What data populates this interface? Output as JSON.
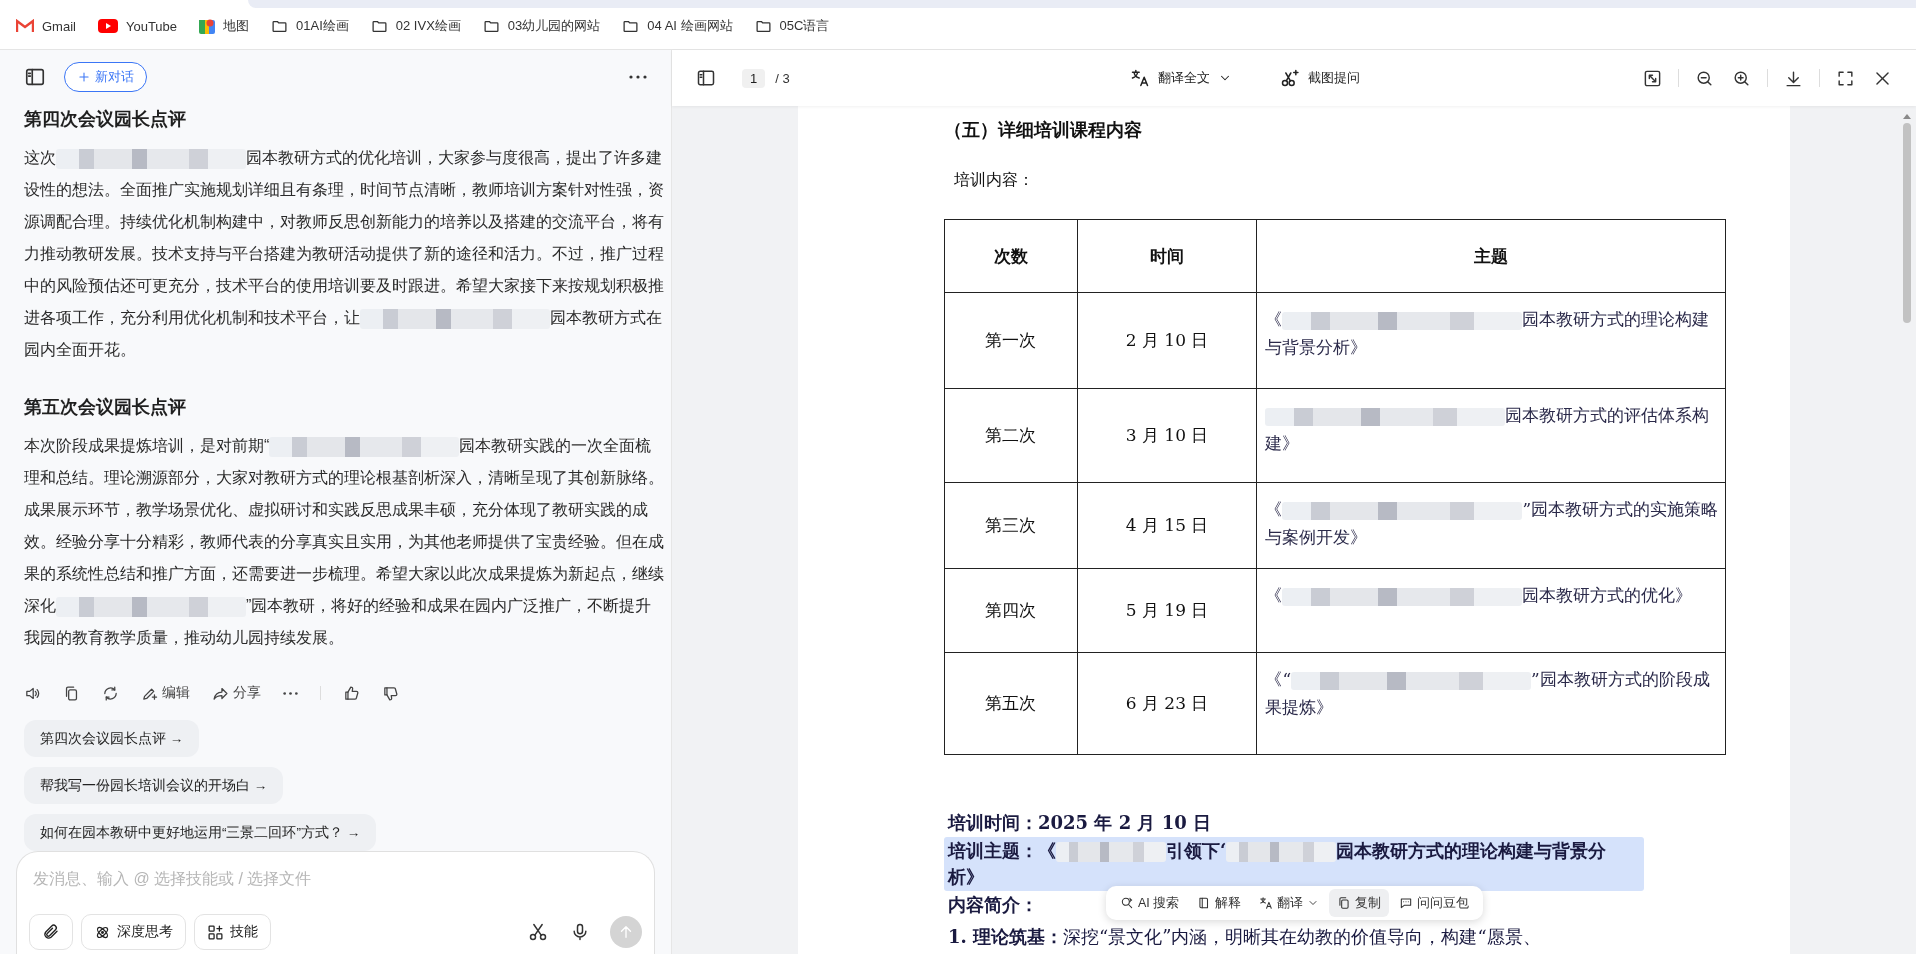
{
  "bookmarks": [
    {
      "kind": "gmail",
      "label": "Gmail"
    },
    {
      "kind": "youtube",
      "label": "YouTube"
    },
    {
      "kind": "maps",
      "label": "地图"
    },
    {
      "kind": "folder",
      "label": "01AI绘画"
    },
    {
      "kind": "folder",
      "label": "02 IVX绘画"
    },
    {
      "kind": "folder",
      "label": "03幼儿园的网站"
    },
    {
      "kind": "folder",
      "label": "04 AI 绘画网站"
    },
    {
      "kind": "folder",
      "label": "05C语言"
    }
  ],
  "chat": {
    "new_chat": "新对话",
    "blocks": [
      {
        "kind": "heading",
        "segments": [
          {
            "kind": "text",
            "text": "第四次会议园长点评"
          }
        ]
      },
      {
        "kind": "para",
        "segments": [
          {
            "kind": "text",
            "text": "这次"
          },
          {
            "kind": "blur"
          },
          {
            "kind": "text",
            "text": "园本教研方式的优化培训，大家参与度很高，提出了许多建设性的想法。全面推广实施规划详细且有条理，时间节点清晰，教师培训方案针对性强，资源调配合理。持续优化机制构建中，对教师反思创新能力的培养以及搭建的交流平台，将有力推动教研发展。技术支持与平台搭建为教研活动提供了新的途径和活力。不过，推广过程中的风险预估还可更充分，技术平台的使用培训要及时跟进。希望大家接下来按规划积极推进各项工作，充分利用优化机制和技术平台，让"
          },
          {
            "kind": "blur"
          },
          {
            "kind": "text",
            "text": "园本教研方式在园内全面开花。"
          }
        ]
      },
      {
        "kind": "heading",
        "segments": [
          {
            "kind": "text",
            "text": "第五次会议园长点评"
          }
        ]
      },
      {
        "kind": "para",
        "segments": [
          {
            "kind": "text",
            "text": "本次阶段成果提炼培训，是对前期“"
          },
          {
            "kind": "blur"
          },
          {
            "kind": "text",
            "text": "园本教研实践的一次全面梳理和总结。理论溯源部分，大家对教研方式的理论根基剖析深入，清晰呈现了其创新脉络。成果展示环节，教学场景优化、虚拟研讨和实践反思成果丰硕，充分体现了教研实践的成效。经验分享十分精彩，教师代表的分享真实且实用，为其他老师提供了宝贵经验。但在成果的系统性总结和推广方面，还需要进一步梳理。希望大家以此次成果提炼为新起点，继续深化"
          },
          {
            "kind": "blur"
          },
          {
            "kind": "text",
            "text": "”园本教研，将好的经验和成果在园内广泛推广，不断提升我园的教育教学质量，推动幼儿园持续发展。"
          }
        ]
      }
    ],
    "actions": [
      {
        "kind": "speaker"
      },
      {
        "kind": "copy"
      },
      {
        "kind": "refresh"
      },
      {
        "kind": "edit",
        "label": "编辑"
      },
      {
        "kind": "share",
        "label": "分享"
      },
      {
        "kind": "more"
      },
      {
        "kind": "divider"
      },
      {
        "kind": "like"
      },
      {
        "kind": "dislike"
      }
    ],
    "suggestions": [
      "第四次会议园长点评 →",
      "帮我写一份园长培训会议的开场白 →",
      "如何在园本教研中更好地运用“三景二回环”方式？ →"
    ],
    "input": {
      "placeholder": "发消息、输入 @ 选择技能或 / 选择文件",
      "deep_think": "深度思考",
      "skills": "技能",
      "send_disabled": true
    }
  },
  "pdf": {
    "page": "1",
    "page_total": "/ 3",
    "translate": "翻译全文",
    "screenshot_ask": "截图提问",
    "section_title": "（五）详细培训课程内容",
    "intro": "培训内容：",
    "table": {
      "columns": [
        "次数",
        "时间",
        "主题"
      ],
      "rows": [
        {
          "count": "第一次",
          "date": "2 月 10 日",
          "topic": [
            {
              "kind": "text",
              "text": "《"
            },
            {
              "kind": "blur"
            },
            {
              "kind": "text",
              "text": "园本教研方式的理论构建与背景分析》"
            }
          ]
        },
        {
          "count": "第二次",
          "date": "3 月 10 日",
          "topic": [
            {
              "kind": "blur"
            },
            {
              "kind": "text",
              "text": "园本教研方式的评估体系构建》"
            }
          ]
        },
        {
          "count": "第三次",
          "date": "4 月 15 日",
          "topic": [
            {
              "kind": "text",
              "text": "《"
            },
            {
              "kind": "blur"
            },
            {
              "kind": "text",
              "text": "”园本教研方式的实施策略与案例开发》"
            }
          ]
        },
        {
          "count": "第四次",
          "date": "5 月 19 日",
          "topic": [
            {
              "kind": "text",
              "text": "《"
            },
            {
              "kind": "blur"
            },
            {
              "kind": "text",
              "text": "园本教研方式的优化》"
            }
          ]
        },
        {
          "count": "第五次",
          "date": "6 月 23 日",
          "topic": [
            {
              "kind": "text",
              "text": "《“"
            },
            {
              "kind": "blur"
            },
            {
              "kind": "text",
              "text": "”园本教研方式的阶段成果提炼》"
            }
          ]
        }
      ]
    },
    "lines": [
      {
        "selected": false,
        "segments": [
          {
            "kind": "text",
            "text": "培训时间：2025 年 2 月 10 日"
          }
        ]
      },
      {
        "selected": true,
        "segments": [
          {
            "kind": "text",
            "text": "培训主题：《"
          },
          {
            "kind": "blur"
          },
          {
            "kind": "text",
            "text": "引领下‘"
          },
          {
            "kind": "blur"
          },
          {
            "kind": "text",
            "text": "园本教研方式的理论构建与背景分析》"
          }
        ]
      },
      {
        "selected": false,
        "segments": [
          {
            "kind": "text",
            "text": "内容简介："
          }
        ]
      },
      {
        "selected": false,
        "segments": [
          {
            "kind": "text",
            "text": "**1. 理论筑基：**深挖“景文化”内涵，明晰其在幼教的价值导向，构建“愿景、"
          }
        ]
      }
    ],
    "selection_menu": [
      {
        "kind": "search",
        "label": "AI 搜索",
        "selected": false
      },
      {
        "kind": "explain",
        "label": "解释",
        "selected": false
      },
      {
        "kind": "translate",
        "label": "翻译",
        "selected": false
      },
      {
        "kind": "copy",
        "label": "复制",
        "selected": true
      },
      {
        "kind": "ask",
        "label": "问问豆包",
        "selected": false
      }
    ]
  }
}
